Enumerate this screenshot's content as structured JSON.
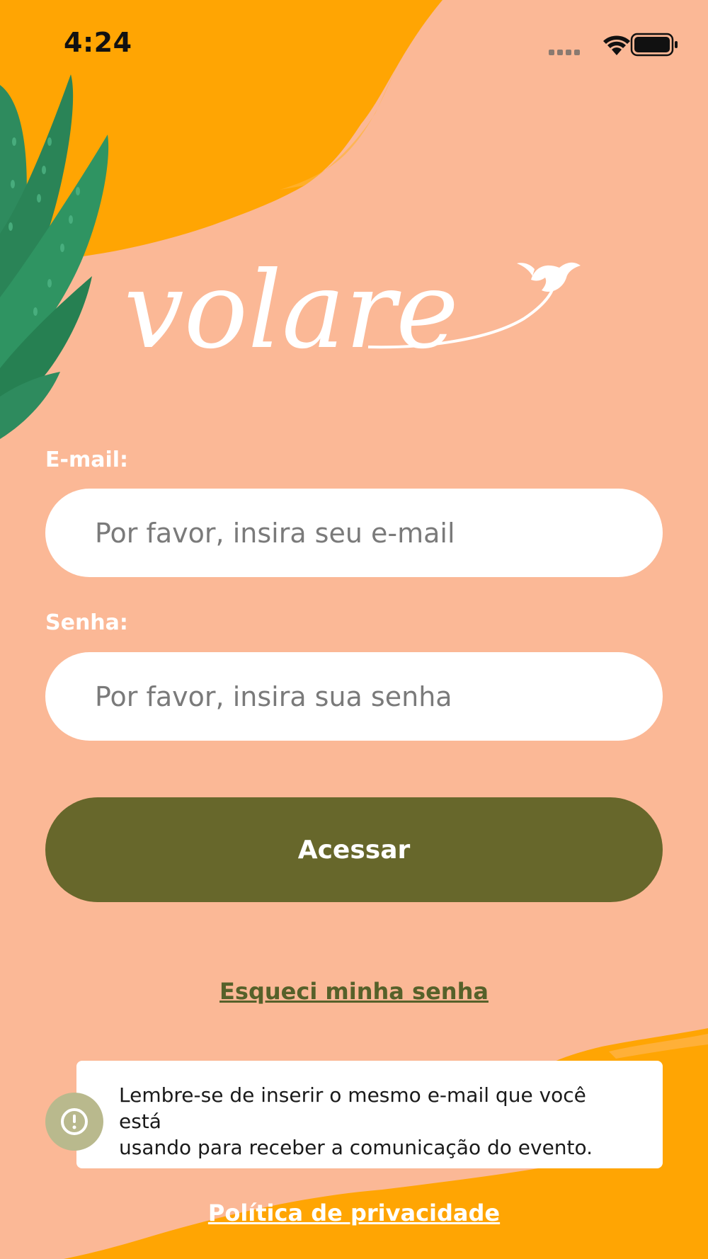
{
  "status_bar": {
    "time": "4:24",
    "signal_icon": "cellular-dots-icon",
    "wifi_icon": "wifi-icon",
    "battery_icon": "battery-icon"
  },
  "brand": {
    "logo_text": "volare",
    "logo_icon": "bird-icon"
  },
  "form": {
    "email_label": "E-mail:",
    "email_placeholder": "Por favor, insira seu e-mail",
    "email_value": "",
    "password_label": "Senha:",
    "password_placeholder": "Por favor, insira sua senha",
    "password_value": "",
    "submit_label": "Acessar"
  },
  "links": {
    "forgot_password": "Esqueci minha senha",
    "privacy_policy": "Política de privacidade"
  },
  "notice": {
    "icon": "alert-circle-icon",
    "text_line_1": "Lembre-se de inserir o mesmo e-mail que você está",
    "text_line_2": "usando para receber a comunicação do evento."
  },
  "colors": {
    "background": "#FBB896",
    "accent_orange": "#FFA503",
    "leaf_green": "#2E8B5E",
    "button": "#67672B",
    "link": "#56612A",
    "notice_badge": "#B9B98D"
  }
}
